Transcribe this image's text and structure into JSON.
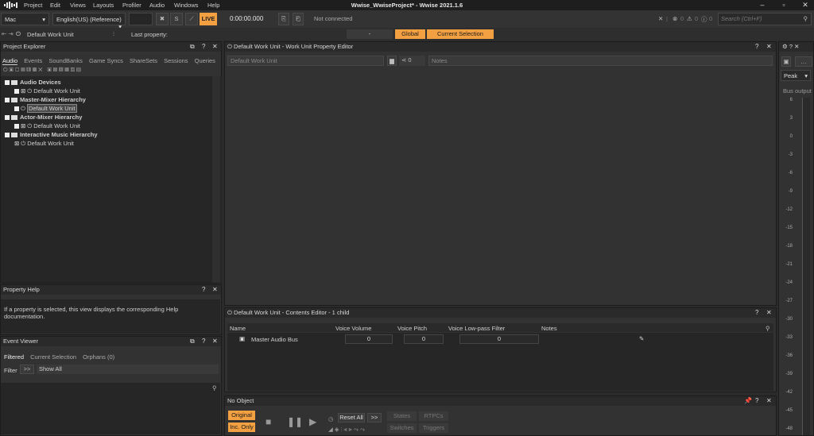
{
  "menu": {
    "items": [
      "Project",
      "Edit",
      "Views",
      "Layouts",
      "Profiler",
      "Audio",
      "Windows",
      "Help"
    ],
    "title": "Wwise_WwiseProject* - Wwise 2021.1.6"
  },
  "toolbar": {
    "platform": "Mac",
    "language": "English(US) (Reference)",
    "solo_label": "S",
    "live_label": "LIVE",
    "time": "0:00:00.000",
    "connection": "Not connected",
    "search_placeholder": "Search (Ctrl+F)",
    "err_count": "0",
    "warn_count": "0",
    "info_count": "0"
  },
  "bar2": {
    "work_unit": "Default Work Unit",
    "last_property": "Last property:",
    "dash": "-",
    "global": "Global",
    "current_selection": "Current Selection"
  },
  "project_explorer": {
    "title": "Project Explorer",
    "tabs": [
      "Audio",
      "Events",
      "SoundBanks",
      "Game Syncs",
      "ShareSets",
      "Sessions",
      "Queries"
    ],
    "tree": [
      {
        "label": "Audio Devices",
        "bold": true
      },
      {
        "label": "Default Work Unit",
        "bold": false
      },
      {
        "label": "Master-Mixer Hierarchy",
        "bold": true
      },
      {
        "label": "Default Work Unit",
        "bold": false,
        "selected": true
      },
      {
        "label": "Actor-Mixer Hierarchy",
        "bold": true
      },
      {
        "label": "Default Work Unit",
        "bold": false
      },
      {
        "label": "Interactive Music Hierarchy",
        "bold": true
      },
      {
        "label": "Default Work Unit",
        "bold": false
      }
    ]
  },
  "property_help": {
    "title": "Property Help",
    "text": "If a property is selected, this view displays the corresponding Help documentation."
  },
  "event_viewer": {
    "title": "Event Viewer",
    "tabs": [
      "Filtered",
      "Current Selection",
      "Orphans (0)"
    ],
    "filter_label": "Filter",
    "filter_btn": ">>",
    "show_all": "Show All"
  },
  "property_editor": {
    "title": "Default Work Unit - Work Unit Property Editor",
    "name_field": "Default Work Unit",
    "count": "0",
    "notes_placeholder": "Notes"
  },
  "contents_editor": {
    "title": "Default Work Unit - Contents Editor - 1 child",
    "columns": [
      "Name",
      "Voice Volume",
      "Voice Pitch",
      "Voice Low-pass Filter",
      "Notes"
    ],
    "rows": [
      {
        "name": "Master Audio Bus",
        "volume": "0",
        "pitch": "0",
        "lpf": "0"
      }
    ]
  },
  "transport": {
    "title": "No Object",
    "original": "Original",
    "inc_only": "Inc. Only",
    "reset_all": "Reset All",
    "more": ">>",
    "states": "States",
    "rtpcs": "RTPCs",
    "switches": "Switches",
    "triggers": "Triggers"
  },
  "meter": {
    "mode": "Peak",
    "label": "Bus output",
    "ticks": [
      "6",
      "3",
      "0",
      "-3",
      "-6",
      "-9",
      "-12",
      "-15",
      "-18",
      "-21",
      "-24",
      "-27",
      "-30",
      "-33",
      "-36",
      "-39",
      "-42",
      "-45",
      "-48"
    ]
  },
  "colors": {
    "accent": "#f2a041",
    "bg": "#2b2b2b",
    "panel": "#323232"
  }
}
